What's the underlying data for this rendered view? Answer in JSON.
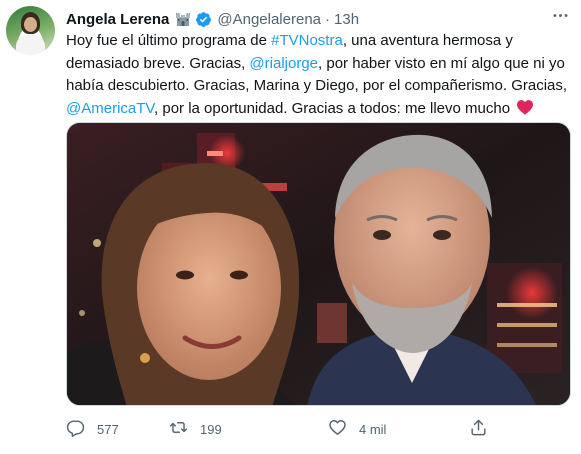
{
  "tweet": {
    "author_name": "Angela Lerena",
    "handle": "@Angelalerena",
    "separator": "·",
    "time": "13h",
    "text": {
      "p1": "Hoy fue el último programa de ",
      "hashtag": "#TVNostra",
      "p2": ", una aventura hermosa y demasiado breve. Gracias, ",
      "mention1": "@rialjorge",
      "p3": ", por haber visto en mí algo que ni yo había descubierto. Gracias, Marina y Diego, por el compañerismo. Gracias, ",
      "mention2": "@AmericaTV",
      "p4": ", por la oportunidad. Gracias a todos: me llevo mucho"
    },
    "icons": {
      "avatar": "profile-photo",
      "castle": "castle-emoji",
      "verified": "verified-badge",
      "more": "more-horizontal-icon",
      "heart": "red-heart-emoji",
      "reply": "reply-icon",
      "retweet": "retweet-icon",
      "like": "like-icon",
      "share": "share-icon"
    },
    "media_alt": "photo",
    "actions": {
      "replies": "577",
      "retweets": "199",
      "likes": "4 mil"
    },
    "colors": {
      "link": "#1d9bf0",
      "verified": "#1d9bf0",
      "text": "#0f1419",
      "secondary": "#536471",
      "heart": "#e0245e"
    }
  }
}
